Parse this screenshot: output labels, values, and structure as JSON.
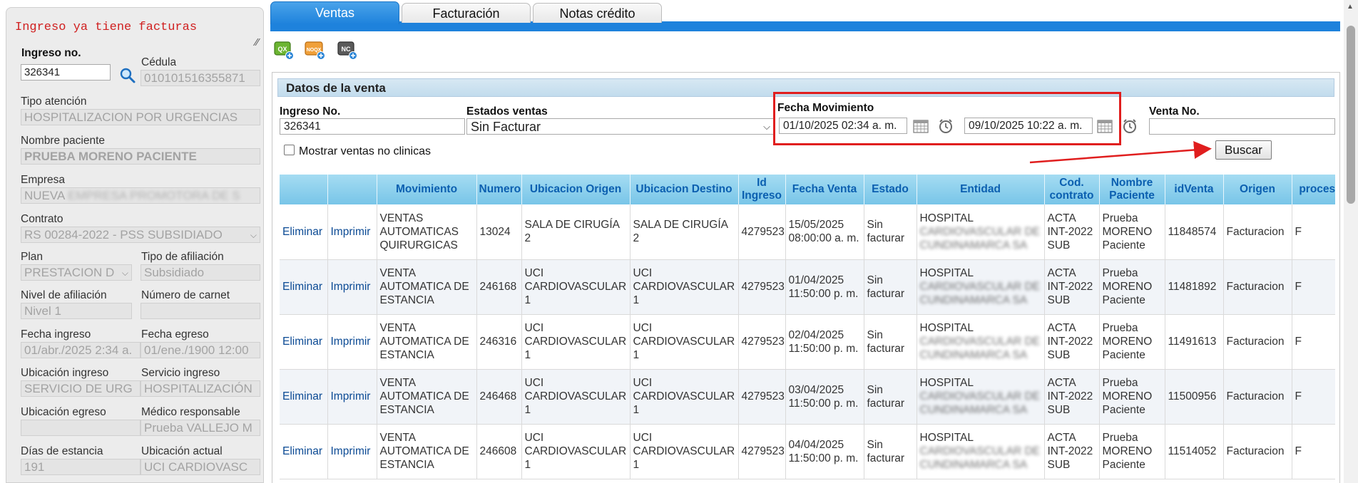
{
  "warning": "Ingreso ya tiene facturas",
  "patient": {
    "ingreso_label": "Ingreso no.",
    "ingreso_value": "326341",
    "cedula_label": "Cédula",
    "cedula_value": "010101516355871",
    "tipo_atencion_label": "Tipo atención",
    "tipo_atencion_value": "HOSPITALIZACION POR URGENCIAS",
    "nombre_label": "Nombre paciente",
    "nombre_value": "PRUEBA MORENO PACIENTE",
    "empresa_label": "Empresa",
    "empresa_value_prefix": "NUEVA",
    "empresa_value_hidden": "EMPRESA PROMOTORA DE S",
    "contrato_label": "Contrato",
    "contrato_value": "RS 00284-2022 - PSS SUBSIDIADO",
    "plan_label": "Plan",
    "plan_value": "PRESTACION D",
    "tipo_afiliacion_label": "Tipo de afiliación",
    "tipo_afiliacion_value": "Subsidiado",
    "nivel_label": "Nivel de afiliación",
    "nivel_value": "Nivel 1",
    "carnet_label": "Número de carnet",
    "carnet_value": "",
    "fecha_ingreso_label": "Fecha ingreso",
    "fecha_ingreso_value": "01/abr./2025 2:34 a.",
    "fecha_egreso_label": "Fecha egreso",
    "fecha_egreso_value": "01/ene./1900 12:00",
    "ubicacion_ingreso_label": "Ubicación ingreso",
    "ubicacion_ingreso_value": "SERVICIO DE URG",
    "servicio_ingreso_label": "Servicio ingreso",
    "servicio_ingreso_value": "HOSPITALIZACIÓN",
    "ubicacion_egreso_label": "Ubicación egreso",
    "ubicacion_egreso_value": "",
    "medico_label": "Médico responsable",
    "medico_value": "Prueba VALLEJO M",
    "dias_label": "Días de estancia",
    "dias_value": "191",
    "ubicacion_actual_label": "Ubicación actual",
    "ubicacion_actual_value": "UCI CARDIOVASC"
  },
  "tabs": [
    {
      "label": "Ventas",
      "active": true
    },
    {
      "label": "Facturación",
      "active": false
    },
    {
      "label": "Notas crédito",
      "active": false
    }
  ],
  "toolbar": [
    {
      "name": "qx-add-icon",
      "text": "QX",
      "color": "#5aa428"
    },
    {
      "name": "noqx-add-icon",
      "text": "NOQX",
      "color": "#e8922a"
    },
    {
      "name": "nc-add-icon",
      "text": "NC",
      "color": "#4a4a4a"
    }
  ],
  "section_title": "Datos de la venta",
  "filters": {
    "ingreso_label": "Ingreso No.",
    "ingreso_value": "326341",
    "estados_label": "Estados ventas",
    "estados_value": "Sin Facturar",
    "fecha_label": "Fecha Movimiento",
    "fecha_desde": "01/10/2025 02:34 a. m.",
    "fecha_hasta": "09/10/2025 10:22 a. m.",
    "venta_label": "Venta No.",
    "venta_value": "",
    "checkbox_label": "Mostrar ventas no clinicas",
    "buscar_label": "Buscar"
  },
  "table": {
    "headers": [
      "",
      "",
      "Movimiento",
      "Numero",
      "Ubicacion Origen",
      "Ubicacion Destino",
      "Id Ingreso",
      "Fecha Venta",
      "Estado",
      "Entidad",
      "Cod. contrato",
      "Nombre Paciente",
      "idVenta",
      "Origen",
      "proceso"
    ],
    "rows": [
      {
        "eliminar": "Eliminar",
        "imprimir": "Imprimir",
        "movimiento": "VENTAS AUTOMATICAS QUIRURGICAS",
        "numero": "13024",
        "origen": "SALA DE CIRUGÍA 2",
        "destino": "SALA DE CIRUGÍA 2",
        "id_ingreso": "4279523",
        "fecha": "15/05/2025 08:00:00 a. m.",
        "estado": "Sin facturar",
        "entidad": "HOSPITAL",
        "entidad_hidden": "CARDIOVASCULAR DE CUNDINAMARCA SA",
        "cod": "ACTA INT-2022 SUB",
        "paciente": "Prueba MORENO Paciente",
        "idventa": "11848574",
        "origen_col": "Facturacion",
        "proceso": "F"
      },
      {
        "eliminar": "Eliminar",
        "imprimir": "Imprimir",
        "movimiento": "VENTA AUTOMATICA DE ESTANCIA",
        "numero": "246168",
        "origen": "UCI CARDIOVASCULAR 1",
        "destino": "UCI CARDIOVASCULAR 1",
        "id_ingreso": "4279523",
        "fecha": "01/04/2025 11:50:00 p. m.",
        "estado": "Sin facturar",
        "entidad": "HOSPITAL",
        "entidad_hidden": "CARDIOVASCULAR DE CUNDINAMARCA SA",
        "cod": "ACTA INT-2022 SUB",
        "paciente": "Prueba MORENO Paciente",
        "idventa": "11481892",
        "origen_col": "Facturacion",
        "proceso": "F"
      },
      {
        "eliminar": "Eliminar",
        "imprimir": "Imprimir",
        "movimiento": "VENTA AUTOMATICA DE ESTANCIA",
        "numero": "246316",
        "origen": "UCI CARDIOVASCULAR 1",
        "destino": "UCI CARDIOVASCULAR 1",
        "id_ingreso": "4279523",
        "fecha": "02/04/2025 11:50:00 p. m.",
        "estado": "Sin facturar",
        "entidad": "HOSPITAL",
        "entidad_hidden": "CARDIOVASCULAR DE CUNDINAMARCA SA",
        "cod": "ACTA INT-2022 SUB",
        "paciente": "Prueba MORENO Paciente",
        "idventa": "11491613",
        "origen_col": "Facturacion",
        "proceso": "F"
      },
      {
        "eliminar": "Eliminar",
        "imprimir": "Imprimir",
        "movimiento": "VENTA AUTOMATICA DE ESTANCIA",
        "numero": "246468",
        "origen": "UCI CARDIOVASCULAR 1",
        "destino": "UCI CARDIOVASCULAR 1",
        "id_ingreso": "4279523",
        "fecha": "03/04/2025 11:50:00 p. m.",
        "estado": "Sin facturar",
        "entidad": "HOSPITAL",
        "entidad_hidden": "CARDIOVASCULAR DE CUNDINAMARCA SA",
        "cod": "ACTA INT-2022 SUB",
        "paciente": "Prueba MORENO Paciente",
        "idventa": "11500956",
        "origen_col": "Facturacion",
        "proceso": "F"
      },
      {
        "eliminar": "Eliminar",
        "imprimir": "Imprimir",
        "movimiento": "VENTA AUTOMATICA DE ESTANCIA",
        "numero": "246608",
        "origen": "UCI CARDIOVASCULAR 1",
        "destino": "UCI CARDIOVASCULAR 1",
        "id_ingreso": "4279523",
        "fecha": "04/04/2025 11:50:00 p. m.",
        "estado": "Sin facturar",
        "entidad": "HOSPITAL",
        "entidad_hidden": "CARDIOVASCULAR DE CUNDINAMARCA SA",
        "cod": "ACTA INT-2022 SUB",
        "paciente": "Prueba MORENO Paciente",
        "idventa": "11514052",
        "origen_col": "Facturacion",
        "proceso": "F"
      }
    ]
  },
  "colors": {
    "accent": "#1e82dc",
    "header_text": "#0b5fb0",
    "link": "#0b4a94",
    "warning": "#d02020",
    "highlight": "#e01e1e"
  }
}
